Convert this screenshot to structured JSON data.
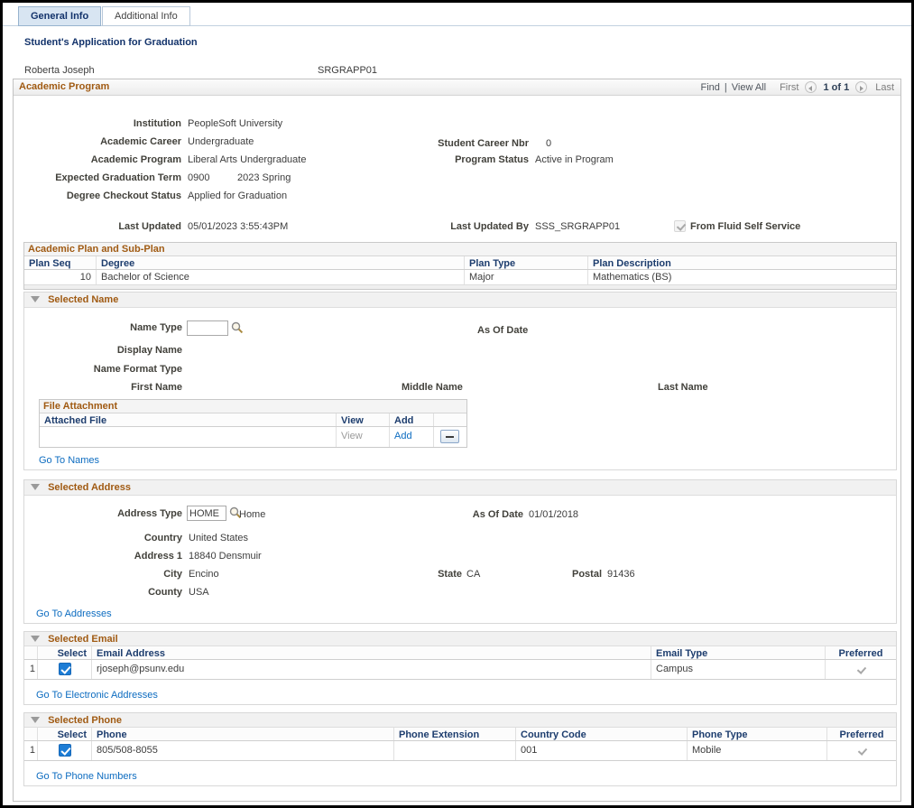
{
  "tabs": {
    "general": "General Info",
    "additional": "Additional Info"
  },
  "header": {
    "title": "Student's Application for Graduation",
    "student_name": "Roberta Joseph",
    "student_id": "SRGRAPP01"
  },
  "program": {
    "title": "Academic Program",
    "toolbar": {
      "find": "Find",
      "divider": "|",
      "view_all": "View All",
      "first": "First",
      "counter": "1 of 1",
      "last": "Last"
    },
    "fields": {
      "institution_label": "Institution",
      "institution_value": "PeopleSoft University",
      "career_label": "Academic Career",
      "career_value": "Undergraduate",
      "student_career_nbr_label": "Student Career Nbr",
      "student_career_nbr_value": "0",
      "program_label": "Academic Program",
      "program_value": "Liberal Arts Undergraduate",
      "program_status_label": "Program Status",
      "program_status_value": "Active in Program",
      "expected_term_label": "Expected Graduation Term",
      "expected_term_code": "0900",
      "expected_term_desc": "2023 Spring",
      "degree_checkout_label": "Degree Checkout Status",
      "degree_checkout_value": "Applied for Graduation",
      "last_updated_label": "Last Updated",
      "last_updated_value": "05/01/2023 3:55:43PM",
      "last_updated_by_label": "Last Updated By",
      "last_updated_by_value": "SSS_SRGRAPP01",
      "from_fluid_label": "From Fluid Self Service",
      "from_fluid_checked": true
    }
  },
  "plan_grid": {
    "title": "Academic Plan and Sub-Plan",
    "headers": {
      "plan_seq": "Plan Seq",
      "degree": "Degree",
      "plan_type": "Plan Type",
      "plan_description": "Plan Description"
    },
    "rows": [
      {
        "plan_seq": "10",
        "degree": "Bachelor of Science",
        "plan_type": "Major",
        "plan_description": "Mathematics (BS)"
      }
    ]
  },
  "name_section": {
    "title": "Selected Name",
    "name_type_label": "Name Type",
    "name_type_value": "",
    "as_of_date_label": "As Of Date",
    "display_name_label": "Display Name",
    "name_format_label": "Name Format Type",
    "first_name_label": "First Name",
    "middle_name_label": "Middle Name",
    "last_name_label": "Last Name",
    "attachment": {
      "title": "File Attachment",
      "headers": {
        "attached_file": "Attached File",
        "view": "View",
        "add": "Add"
      },
      "rows": [
        {
          "attached_file": "",
          "view": "View",
          "add": "Add"
        }
      ]
    },
    "go_to": "Go To Names"
  },
  "address_section": {
    "title": "Selected Address",
    "address_type_label": "Address Type",
    "address_type_value": "HOME",
    "address_type_desc": "Home",
    "as_of_label": "As Of Date",
    "as_of_value": "01/01/2018",
    "country_label": "Country",
    "country_value": "United States",
    "address1_label": "Address 1",
    "address1_value": "18840 Densmuir",
    "city_label": "City",
    "city_value": "Encino",
    "state_label": "State",
    "state_value": "CA",
    "postal_label": "Postal",
    "postal_value": "91436",
    "county_label": "County",
    "county_value": "USA",
    "go_to": "Go To Addresses"
  },
  "email_section": {
    "title": "Selected Email",
    "headers": {
      "select": "Select",
      "email_address": "Email Address",
      "email_type": "Email Type",
      "preferred": "Preferred"
    },
    "rows": [
      {
        "nbr": "1",
        "selected": true,
        "email_address": "rjoseph@psunv.edu",
        "email_type": "Campus",
        "preferred": true
      }
    ],
    "go_to": "Go To Electronic Addresses"
  },
  "phone_section": {
    "title": "Selected Phone",
    "headers": {
      "select": "Select",
      "phone": "Phone",
      "extension": "Phone Extension",
      "country_code": "Country Code",
      "phone_type": "Phone Type",
      "preferred": "Preferred"
    },
    "rows": [
      {
        "nbr": "1",
        "selected": true,
        "phone": "805/508-8055",
        "extension": "",
        "country_code": "001",
        "phone_type": "Mobile",
        "preferred": true
      }
    ],
    "go_to": "Go To Phone Numbers"
  },
  "icons": {
    "lookup": "magnifying-glass",
    "collapse": "down-triangle",
    "prev": "left-arrow-circle",
    "next": "right-arrow-circle",
    "minus": "minus-button",
    "checked": "checkmark"
  },
  "colors": {
    "section_title": "#A05A12",
    "link": "#0D6CC0",
    "column_header": "#1D3D6E",
    "active_tab_bg": "#D8E5F2",
    "checkbox_checked": "#1C7CD5"
  }
}
